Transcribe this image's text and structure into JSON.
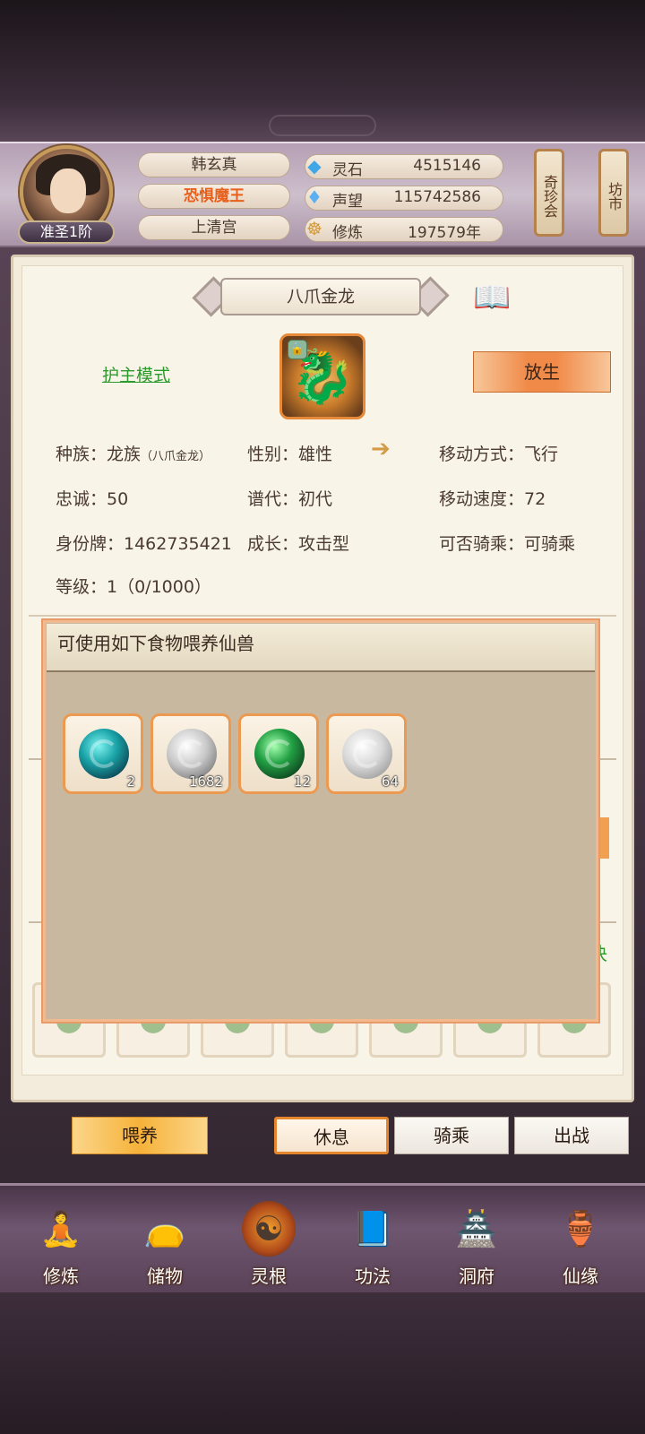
{
  "player": {
    "name": "韩玄真",
    "title": "恐惧魔王",
    "sect": "上清宫",
    "rank": "准圣1阶"
  },
  "resources": [
    {
      "icon": "spirit-stone-icon",
      "label": "灵石",
      "value": "4515146"
    },
    {
      "icon": "prestige-icon",
      "label": "声望",
      "value": "115742586"
    },
    {
      "icon": "cultivation-icon",
      "label": "修炼",
      "value": "197579年"
    }
  ],
  "top_buttons": {
    "treasure_fair": "奇珍会",
    "market": "坊市"
  },
  "pet": {
    "name": "八爪金龙",
    "mode_link": "护主模式",
    "release_label": "放生",
    "attributes": {
      "race_label": "种族：",
      "race_value": "龙族",
      "race_sub": "（八爪金龙）",
      "gender": "性别：雄性",
      "move_type": "移动方式：飞行",
      "loyalty": "忠诚：50",
      "generation": "谱代：初代",
      "move_speed": "移动速度：72",
      "id_tag": "身份牌：1462735421",
      "growth": "成长：攻击型",
      "rideable": "可否骑乘：可骑乘",
      "level": "等级：1（0/1000）"
    }
  },
  "feed_popup": {
    "title": "可使用如下食物喂养仙兽",
    "items": [
      {
        "icon": "teal-spirit-orb-icon",
        "count": "2"
      },
      {
        "icon": "silver-dragon-orb-icon",
        "count": "1682"
      },
      {
        "icon": "green-spirit-orb-icon",
        "count": "12"
      },
      {
        "icon": "silver-spirit-orb-icon",
        "count": "64"
      }
    ]
  },
  "background_fragment": "决",
  "actions": {
    "feed": "喂养",
    "rest": "休息",
    "ride": "骑乘",
    "fight": "出战"
  },
  "nav": [
    {
      "label": "修炼",
      "icon": "meditation-icon"
    },
    {
      "label": "储物",
      "icon": "storage-bag-icon"
    },
    {
      "label": "灵根",
      "icon": "spirit-root-icon"
    },
    {
      "label": "功法",
      "icon": "scripture-book-icon"
    },
    {
      "label": "洞府",
      "icon": "cave-residence-icon"
    },
    {
      "label": "仙缘",
      "icon": "immortal-gourd-icon"
    }
  ]
}
